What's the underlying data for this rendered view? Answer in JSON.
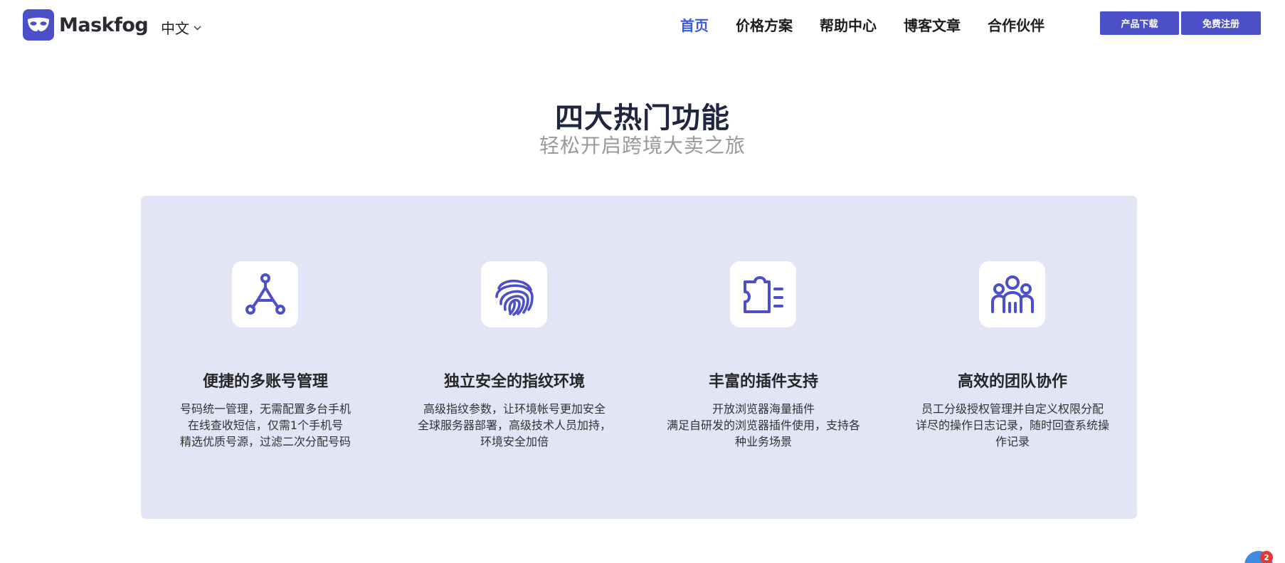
{
  "brand": {
    "name": "Maskfog",
    "logo_icon": "mask-icon",
    "color": "#4b50c9"
  },
  "language": {
    "label": "中文"
  },
  "nav": {
    "items": [
      {
        "label": "首页",
        "active": true
      },
      {
        "label": "价格方案"
      },
      {
        "label": "帮助中心"
      },
      {
        "label": "博客文章"
      },
      {
        "label": "合作伙伴"
      }
    ],
    "active_color": "#3b5bdb"
  },
  "actions": {
    "download_label": "产品下载",
    "register_label": "免费注册"
  },
  "section": {
    "title": "四大热门功能",
    "subtitle": "轻松开启跨境大卖之旅",
    "panel_color": "#e2e5f6"
  },
  "features": [
    {
      "icon": "network-icon",
      "title": "便捷的多账号管理",
      "lines": [
        "号码统一管理，无需配置多台手机",
        "在线查收短信，仅需1个手机号",
        "精选优质号源，过滤二次分配号码"
      ]
    },
    {
      "icon": "fingerprint-icon",
      "title": "独立安全的指纹环境",
      "lines": [
        "高级指纹参数，让环境帐号更加安全",
        "全球服务器部署，高级技术人员加持，",
        "环境安全加倍"
      ]
    },
    {
      "icon": "puzzle-icon",
      "title": "丰富的插件支持",
      "lines": [
        "开放浏览器海量插件",
        "满足自研发的浏览器插件使用，支持各",
        "种业务场景"
      ]
    },
    {
      "icon": "team-icon",
      "title": "高效的团队协作",
      "lines": [
        "员工分级授权管理并自定义权限分配",
        "详尽的操作日志记录，随时回查系统操",
        "作记录"
      ]
    }
  ],
  "chat_widget": {
    "badge_count": "2"
  }
}
